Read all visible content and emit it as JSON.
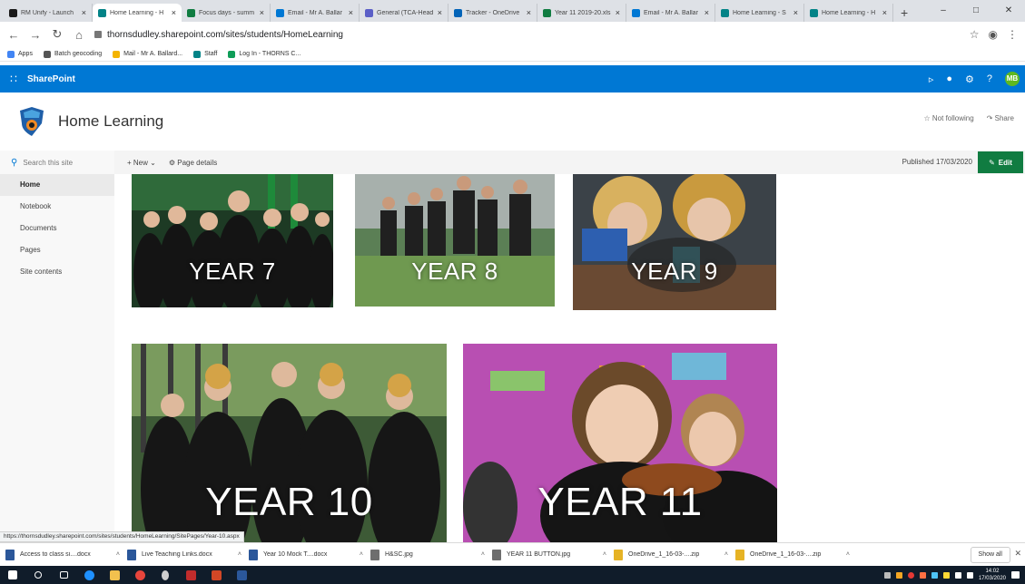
{
  "browser": {
    "tabs": [
      {
        "title": "RM Unify - Launch",
        "color": "#1a1a1a",
        "active": false
      },
      {
        "title": "Home Learning - H",
        "color": "#038387",
        "active": true
      },
      {
        "title": "Focus days - summ",
        "color": "#107c41",
        "active": false
      },
      {
        "title": "Email - Mr A. Ballar",
        "color": "#0078d4",
        "active": false
      },
      {
        "title": "General (TCA-Head",
        "color": "#5b5fc7",
        "active": false
      },
      {
        "title": "Tracker - OneDrive",
        "color": "#0364b8",
        "active": false
      },
      {
        "title": "Year 11 2019-20.xls",
        "color": "#107c41",
        "active": false
      },
      {
        "title": "Email - Mr A. Ballar",
        "color": "#0078d4",
        "active": false
      },
      {
        "title": "Home Learning - S",
        "color": "#038387",
        "active": false
      },
      {
        "title": "Home Learning - H",
        "color": "#038387",
        "active": false
      }
    ],
    "new_tab": "+",
    "url": "thornsdudley.sharepoint.com/sites/students/HomeLearning",
    "bookmarks": [
      {
        "label": "Apps",
        "color": "#4285f4"
      },
      {
        "label": "Batch geocoding",
        "color": "#555555"
      },
      {
        "label": "Mail - Mr A. Ballard...",
        "color": "#f4b400"
      },
      {
        "label": "Staff",
        "color": "#038387"
      },
      {
        "label": "Log In - THORNS C...",
        "color": "#0f9d58"
      }
    ]
  },
  "suite": {
    "brand": "SharePoint",
    "avatar_initials": "MB",
    "bar_color": "#0078d4"
  },
  "site": {
    "title": "Home Learning",
    "follow_label": "Not following",
    "share_label": "Share"
  },
  "nav": {
    "search_placeholder": "Search this site",
    "items": [
      "Home",
      "Notebook",
      "Documents",
      "Pages",
      "Site contents"
    ]
  },
  "commandbar": {
    "new_label": "New",
    "page_details_label": "Page details",
    "published": "Published 17/03/2020",
    "edit_label": "Edit"
  },
  "tiles": [
    {
      "label": "YEAR 7"
    },
    {
      "label": "YEAR 8"
    },
    {
      "label": "YEAR 9"
    },
    {
      "label": "YEAR 10"
    },
    {
      "label": "YEAR 11"
    }
  ],
  "status_url": "https://thornsdudley.sharepoint.com/sites/students/HomeLearning/SitePages/Year-10.aspx",
  "downloads": {
    "items": [
      {
        "name": "Access to class si....docx",
        "color": "#2b579a"
      },
      {
        "name": "Live Teaching Links.docx",
        "color": "#2b579a"
      },
      {
        "name": "Year 10 Mock T....docx",
        "color": "#2b579a"
      },
      {
        "name": "H&SC.jpg",
        "color": "#6e6e6e"
      },
      {
        "name": "YEAR 11 BUTTON.jpg",
        "color": "#6e6e6e"
      },
      {
        "name": "OneDrive_1_16-03-....zip",
        "color": "#e6b325"
      },
      {
        "name": "OneDrive_1_16-03-....zip",
        "color": "#e6b325"
      }
    ],
    "show_all": "Show all"
  },
  "taskbar": {
    "time": "14:02",
    "date": "17/03/2020"
  }
}
